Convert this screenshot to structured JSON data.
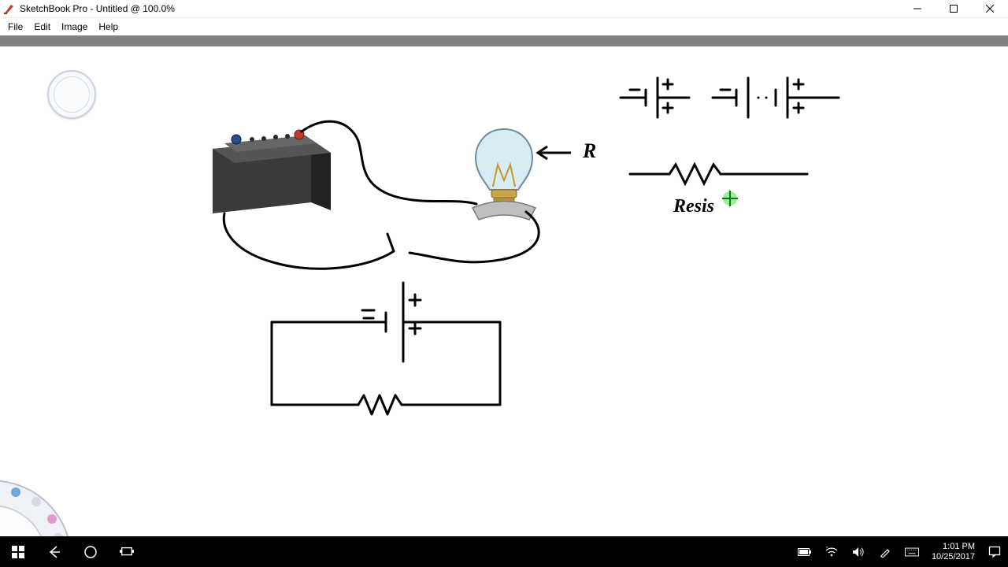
{
  "window": {
    "title": "SketchBook Pro - Untitled @ 100.0%"
  },
  "menu": {
    "items": [
      "File",
      "Edit",
      "Image",
      "Help"
    ]
  },
  "canvas": {
    "annotations": {
      "arrow_label": "R",
      "resistor_label": "Resis"
    },
    "symbols": {
      "cell_minus": "−",
      "cell_plus": "+"
    }
  },
  "taskbar": {
    "time": "1:01 PM",
    "date": "10/25/2017"
  }
}
